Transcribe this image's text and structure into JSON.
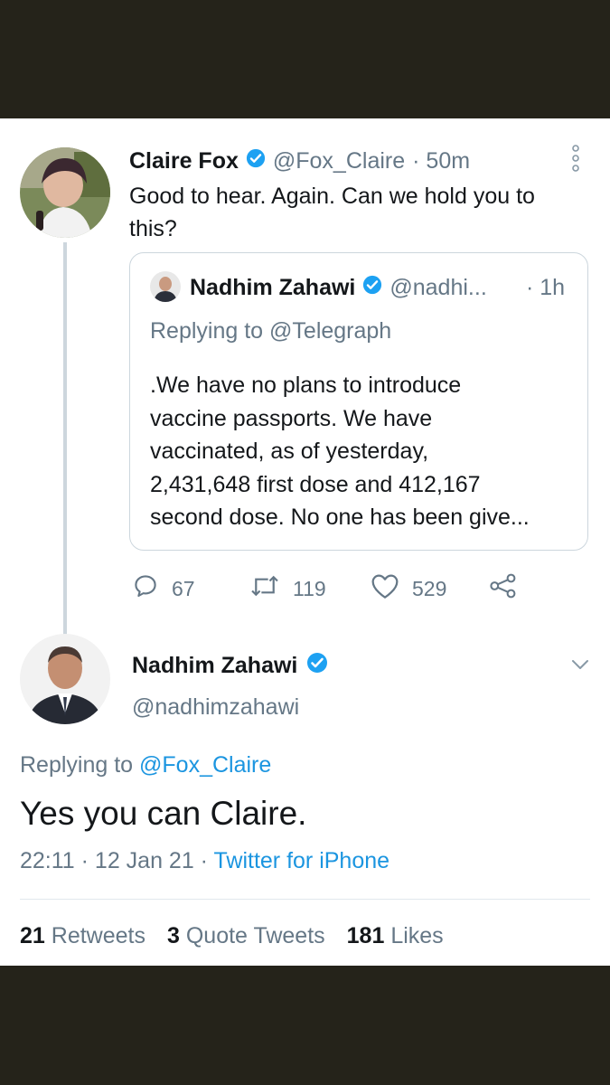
{
  "reply_tweet": {
    "author_name": "Claire Fox",
    "author_handle": "@Fox_Claire",
    "time": "· 50m",
    "text_line1": "Good to hear. Again. Can we hold you to",
    "text_line2": "this?",
    "quoted": {
      "author_name": "Nadhim Zahawi",
      "author_handle": "@nadhi...",
      "time": "· 1h",
      "replying_prefix": "Replying to",
      "replying_to": "@Telegraph",
      "lines": [
        ".We have no plans to introduce",
        "vaccine passports. We have",
        "vaccinated, as of yesterday,",
        "2,431,648 first dose and 412,167",
        "second dose. No one has been give..."
      ]
    },
    "actions": {
      "replies": "67",
      "retweets": "119",
      "likes": "529"
    }
  },
  "main_tweet": {
    "author_name": "Nadhim Zahawi",
    "author_handle": "@nadhimzahawi",
    "replying_prefix": "Replying to",
    "replying_to": "@Fox_Claire",
    "text": "Yes you can Claire.",
    "timestamp": "22:11 · 12 Jan 21 ·",
    "source": "Twitter for iPhone",
    "stats": {
      "retweets_count": "21",
      "retweets_label": "Retweets",
      "quotes_count": "3",
      "quotes_label": "Quote Tweets",
      "likes_count": "181",
      "likes_label": "Likes"
    }
  },
  "colors": {
    "link": "#1b95e0",
    "muted": "#657786",
    "verified": "#1da1f2",
    "frame": "#25231a"
  }
}
